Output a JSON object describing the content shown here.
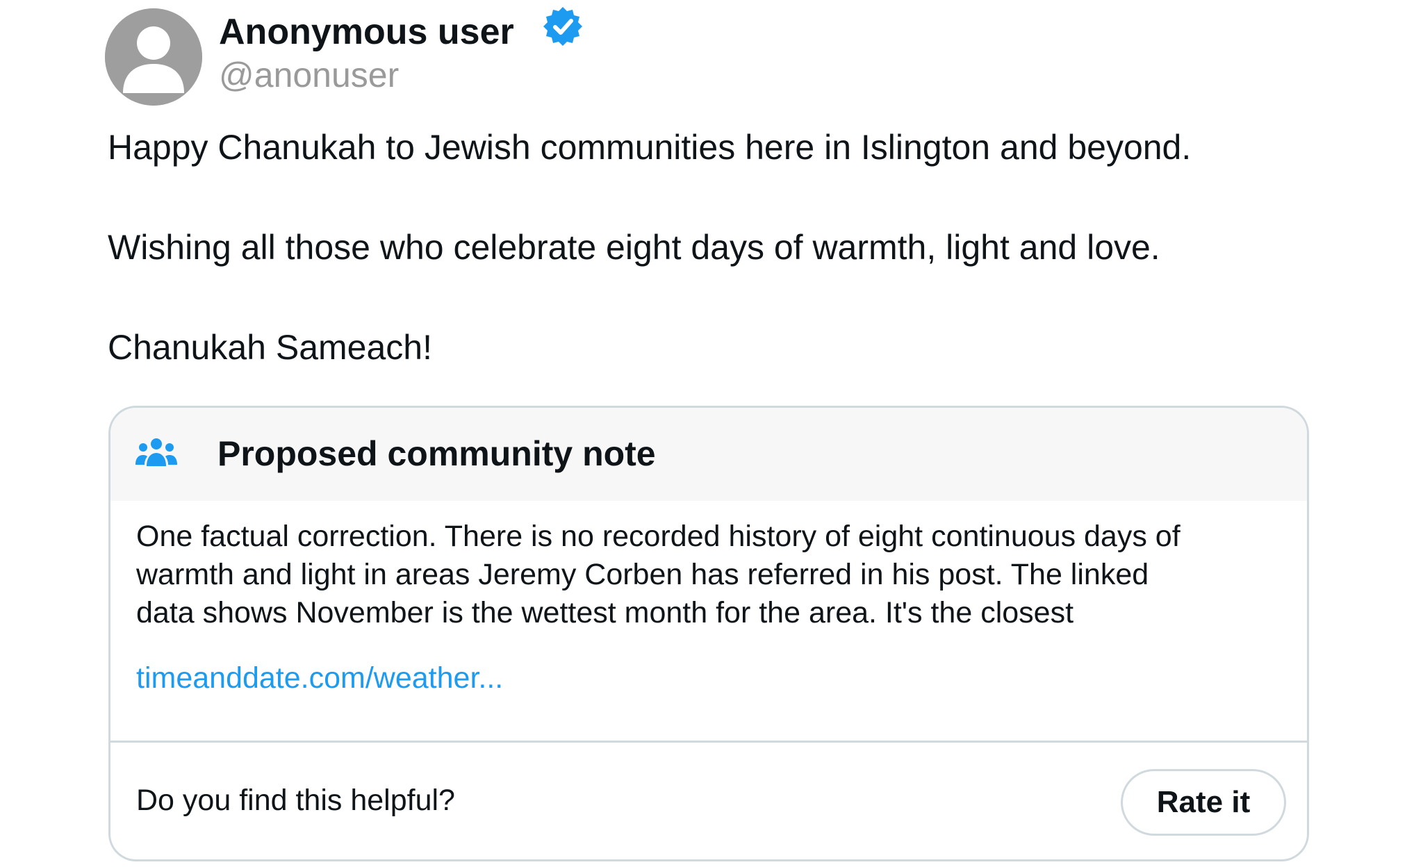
{
  "user": {
    "display_name": "Anonymous user",
    "handle": "@anonuser",
    "verified": true,
    "avatar_icon": "default-avatar-icon",
    "verified_icon": "verified-badge-icon"
  },
  "tweet": {
    "lines": [
      "Happy Chanukah to Jewish communities here in Islington and beyond.",
      "Wishing all those who celebrate eight days of warmth, light and love.",
      "Chanukah Sameach!"
    ]
  },
  "community_note": {
    "icon": "people-group-icon",
    "title": "Proposed community note",
    "body_lines": [
      "One factual correction. There is no recorded history of eight continuous days of",
      "warmth and light in areas Jeremy Corben has referred in his post. The linked",
      "data shows November is the wettest month for the area. It's the closest"
    ],
    "link_text": "timeanddate.com/weather...",
    "helpful_prompt": "Do you find this helpful?",
    "rate_button_label": "Rate it"
  },
  "colors": {
    "link": "#1d9bf0",
    "verified": "#1d9bf0",
    "avatar_bg": "#9e9e9e",
    "border": "#cfd9de",
    "header_bg": "#f7f7f7",
    "handle": "#9a9a9a"
  }
}
